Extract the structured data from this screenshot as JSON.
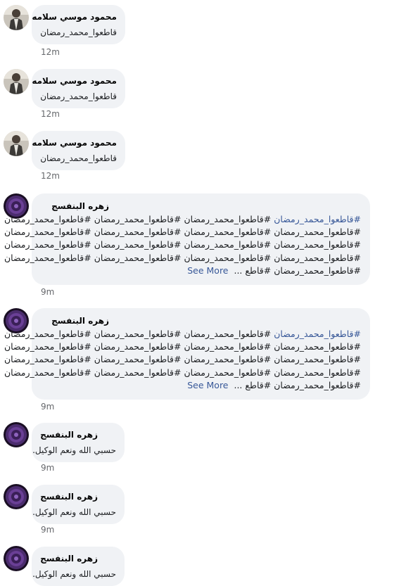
{
  "comments": [
    {
      "author": "محمود موسي سلامه",
      "text": "قاطعوا_محمد_رمضان",
      "time": "12m",
      "avatar_icon": "man-profile-photo"
    },
    {
      "author": "محمود موسي سلامه",
      "text": "قاطعوا_محمد_رمضان",
      "time": "12m",
      "avatar_icon": "man-profile-photo"
    },
    {
      "author": "محمود موسي سلامه",
      "text": "قاطعوا_محمد_رمضان",
      "time": "12m",
      "avatar_icon": "man-profile-photo"
    },
    {
      "author": "زهره البنفسج",
      "lines": [
        {
          "plain": "#قاطعوا_محمد_رمضان #قاطعوا_محمد_رمضان #قاطعوا_محمد_رمضان ",
          "link": "#قاطعوا_محمد_رمضان"
        },
        {
          "plain": "#قاطعوا_محمد_رمضان #قاطعوا_محمد_رمضان #قاطعوا_محمد_رمضان #قاطعوا_محمد_رمضان"
        },
        {
          "plain": "#قاطعوا_محمد_رمضان #قاطعوا_محمد_رمضان #قاطعوا_محمد_رمضان #قاطعوا_محمد_رمضان"
        },
        {
          "plain": "#قاطعوا_محمد_رمضان #قاطعوا_محمد_رمضان #قاطعوا_محمد_رمضان #قاطعوا_محمد_رمضان"
        },
        {
          "plain": "#قاطعوا_محمد_رمضان #قاطع ...",
          "see_more": "See More"
        }
      ],
      "time": "9m",
      "avatar_icon": "purple-flower-photo"
    },
    {
      "author": "زهره البنفسج",
      "lines": [
        {
          "plain": "#قاطعوا_محمد_رمضان #قاطعوا_محمد_رمضان #قاطعوا_محمد_رمضان ",
          "link": "#قاطعوا_محمد_رمضان"
        },
        {
          "plain": "#قاطعوا_محمد_رمضان #قاطعوا_محمد_رمضان #قاطعوا_محمد_رمضان #قاطعوا_محمد_رمضان"
        },
        {
          "plain": "#قاطعوا_محمد_رمضان #قاطعوا_محمد_رمضان #قاطعوا_محمد_رمضان #قاطعوا_محمد_رمضان"
        },
        {
          "plain": "#قاطعوا_محمد_رمضان #قاطعوا_محمد_رمضان #قاطعوا_محمد_رمضان #قاطعوا_محمد_رمضان"
        },
        {
          "plain": "#قاطعوا_محمد_رمضان #قاطع ...",
          "see_more": "See More"
        }
      ],
      "time": "9m",
      "avatar_icon": "purple-flower-photo"
    },
    {
      "author": "زهره البنفسج",
      "text": "حسبي الله ونعم الوكيل.",
      "time": "9m",
      "avatar_icon": "purple-flower-photo"
    },
    {
      "author": "زهره البنفسج",
      "text": "حسبي الله ونعم الوكيل.",
      "time": "9m",
      "avatar_icon": "purple-flower-photo"
    },
    {
      "author": "زهره البنفسج",
      "text": "حسبي الله ونعم الوكيل.",
      "time": "",
      "avatar_icon": "purple-flower-photo"
    }
  ],
  "colors": {
    "bubble": "#f0f2f5",
    "link": "#385898",
    "time": "#65676b"
  }
}
